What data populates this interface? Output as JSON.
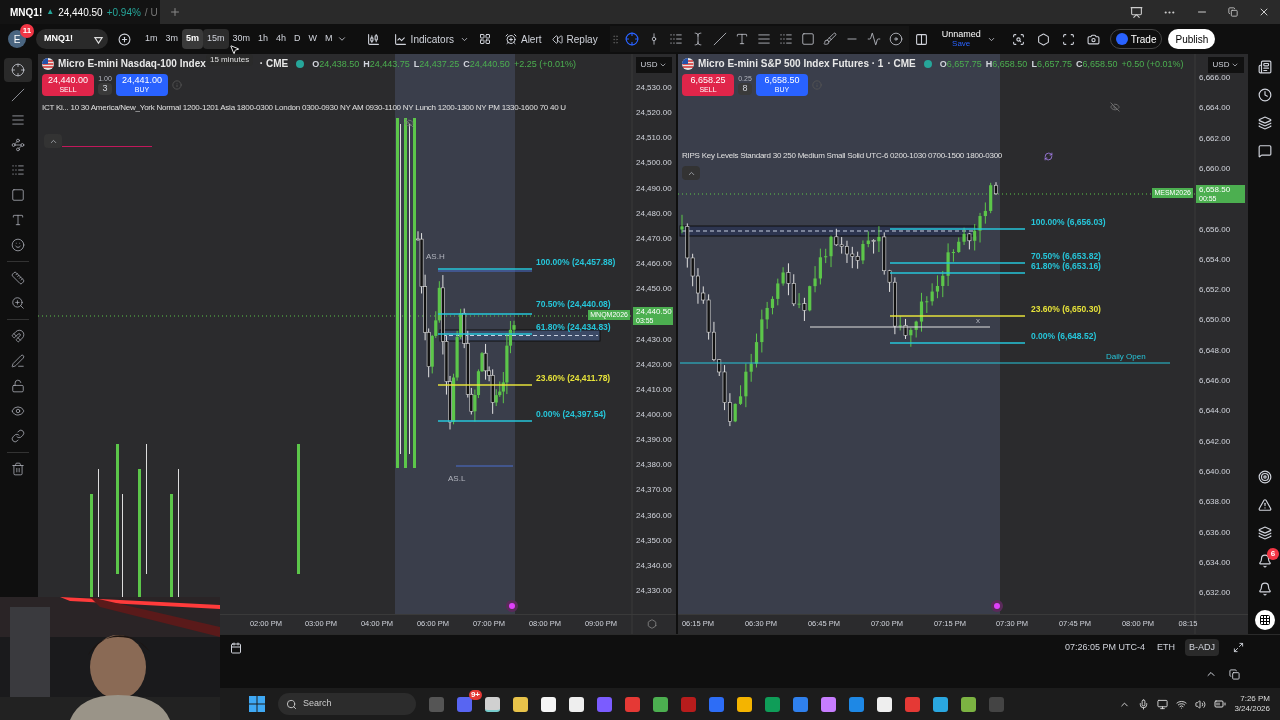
{
  "browser_tab": {
    "symbol": "MNQ1!",
    "arrow": "▲",
    "price": "24,440.50",
    "change": "+0.94%",
    "rest": "/ U"
  },
  "toolbar": {
    "avatar": "E",
    "badge": "11",
    "symbol": "MNQ1!",
    "intervals": [
      {
        "label": "1m",
        "selected": false,
        "hovered": false
      },
      {
        "label": "3m",
        "selected": false,
        "hovered": false
      },
      {
        "label": "5m",
        "selected": true,
        "hovered": false
      },
      {
        "label": "15m",
        "selected": false,
        "hovered": true
      },
      {
        "label": "30m",
        "selected": false,
        "hovered": false
      },
      {
        "label": "1h",
        "selected": false,
        "hovered": false
      },
      {
        "label": "4h",
        "selected": false,
        "hovered": false
      },
      {
        "label": "D",
        "selected": false,
        "hovered": false
      },
      {
        "label": "W",
        "selected": false,
        "hovered": false
      },
      {
        "label": "M",
        "selected": false,
        "hovered": false
      }
    ],
    "tooltip": "15 minutes",
    "indicators": "Indicators",
    "alert": "Alert",
    "replay": "Replay",
    "drawing_tools": [
      {
        "kind": "crosshair",
        "selected": true
      },
      {
        "kind": "vline",
        "selected": false
      },
      {
        "kind": "logs",
        "selected": false
      },
      {
        "kind": "textcursor",
        "selected": false
      },
      {
        "kind": "line",
        "selected": false
      },
      {
        "kind": "text",
        "selected": false
      },
      {
        "kind": "lines",
        "selected": false
      },
      {
        "kind": "logs",
        "selected": false
      },
      {
        "kind": "rect",
        "selected": false
      },
      {
        "kind": "brush",
        "selected": false
      },
      {
        "kind": "hline",
        "selected": false
      },
      {
        "kind": "path",
        "selected": false
      },
      {
        "kind": "disc",
        "selected": false
      }
    ],
    "layout_name": "Unnamed",
    "layout_action": "Save",
    "trade": "Trade",
    "publish": "Publish"
  },
  "left_tools": [
    {
      "kind": "crosshair",
      "selected": true
    },
    {
      "kind": "line",
      "selected": false
    },
    {
      "kind": "lines",
      "selected": false
    },
    {
      "kind": "pattern",
      "selected": false
    },
    {
      "kind": "logs",
      "selected": false
    },
    {
      "kind": "rect",
      "selected": false
    },
    {
      "kind": "text",
      "selected": false
    },
    {
      "kind": "smile",
      "selected": false
    },
    {
      "kind": "ruler",
      "selected": false
    },
    {
      "kind": "zoom",
      "selected": false
    },
    {
      "kind": "magnet",
      "selected": false
    },
    {
      "kind": "pencil",
      "selected": false
    },
    {
      "kind": "lock",
      "selected": false
    },
    {
      "kind": "eye",
      "selected": false
    },
    {
      "kind": "link",
      "selected": false
    },
    {
      "kind": "trash",
      "selected": false
    }
  ],
  "charts": [
    {
      "title": "Micro E-mini Nasdaq-100 Index",
      "exchange": "· CME",
      "ohlc": [
        {
          "key": "O",
          "value": "24,438.50"
        },
        {
          "key": "H",
          "value": "24,443.75"
        },
        {
          "key": "L",
          "value": "24,437.25"
        },
        {
          "key": "C",
          "value": "24,440.50"
        }
      ],
      "change": "+2.25 (+0.01%)",
      "sell": {
        "price": "24,440.00",
        "label": "SELL"
      },
      "step": "1.00",
      "quantity": "3",
      "buy": {
        "price": "24,441.00",
        "label": "BUY"
      },
      "indicator": "ICT Ki... 10 30 America/New_York Normal 1200-1201 Asia 1800-0300 London 0300-0930 NY AM 0930-1100 NY Lunch 1200-1300 NY PM 1330-1600 70 40 U",
      "currency": "USD",
      "price_ticks": [
        "24,530.00",
        "24,520.00",
        "24,510.00",
        "24,500.00",
        "24,490.00",
        "24,480.00",
        "24,470.00",
        "24,460.00",
        "24,450.00",
        "24,430.00",
        "24,420.00",
        "24,410.00",
        "24,400.00",
        "24,390.00",
        "24,380.00",
        "24,370.00",
        "24,360.00",
        "24,350.00",
        "24,340.00",
        "24,330.00"
      ],
      "time_ticks": [
        "02:00 PM",
        "03:00 PM",
        "04:00 PM",
        "06:00 PM",
        "07:00 PM",
        "08:00 PM",
        "09:00 PM"
      ],
      "last_price": {
        "symbol": "MNQM2026",
        "price": "24,440.50",
        "countdown": "03:55"
      },
      "fib_levels": [
        {
          "label": "100.00% (24,457.88)",
          "color": "#26c6da"
        },
        {
          "label": "70.50% (24,440.08)",
          "color": "#26c6da"
        },
        {
          "label": "61.80% (24,434.83)",
          "color": "#26c6da"
        },
        {
          "label": "23.60% (24,411.78)",
          "color": "#e6e23a"
        },
        {
          "label": "0.00% (24,397.54)",
          "color": "#26c6da"
        }
      ],
      "annotations": [
        "AS.H",
        "AS.L"
      ]
    },
    {
      "title": "Micro E-mini S&P 500 Index Futures · 1",
      "exchange": "· CME",
      "ohlc": [
        {
          "key": "O",
          "value": "6,657.75"
        },
        {
          "key": "H",
          "value": "6,658.50"
        },
        {
          "key": "L",
          "value": "6,657.75"
        },
        {
          "key": "C",
          "value": "6,658.50"
        }
      ],
      "change": "+0.50 (+0.01%)",
      "sell": {
        "price": "6,658.25",
        "label": "SELL"
      },
      "step": "0.25",
      "quantity": "8",
      "buy": {
        "price": "6,658.50",
        "label": "BUY"
      },
      "indicator": "RIPS Key Levels Standard 30 250 Medium Small Solid UTC-6 0200-1030 0700-1500 1800-0300",
      "currency": "USD",
      "price_ticks": [
        "6,666.00",
        "6,664.00",
        "6,662.00",
        "6,660.00",
        "6,656.00",
        "6,654.00",
        "6,652.00",
        "6,650.00",
        "6,648.00",
        "6,646.00",
        "6,644.00",
        "6,642.00",
        "6,640.00",
        "6,638.00",
        "6,636.00",
        "6,634.00",
        "6,632.00"
      ],
      "time_ticks": [
        "06:15 PM",
        "06:30 PM",
        "06:45 PM",
        "07:00 PM",
        "07:15 PM",
        "07:30 PM",
        "07:45 PM",
        "08:00 PM",
        "08:15"
      ],
      "last_price": {
        "symbol": "MESM2026",
        "price": "6,658.50",
        "countdown": "00:55"
      },
      "fib_levels": [
        {
          "label": "100.00% (6,656.03)",
          "color": "#26c6da"
        },
        {
          "label": "70.50% (6,653.82)",
          "color": "#26c6da"
        },
        {
          "label": "61.80% (6,653.16)",
          "color": "#26c6da"
        },
        {
          "label": "23.60% (6,650.30)",
          "color": "#e6e23a"
        },
        {
          "label": "0.00% (6,648.52)",
          "color": "#26c6da"
        }
      ],
      "annotations": [
        "x",
        "Daily Open"
      ]
    }
  ],
  "sidebar_badge": "6",
  "status_bar": {
    "time": "07:26:05 PM UTC-4",
    "session": "ETH",
    "adjustment": "B-ADJ"
  },
  "taskbar": {
    "search": "Search",
    "badge": "9+",
    "time": "7:26 PM",
    "date": "3/24/2026"
  }
}
